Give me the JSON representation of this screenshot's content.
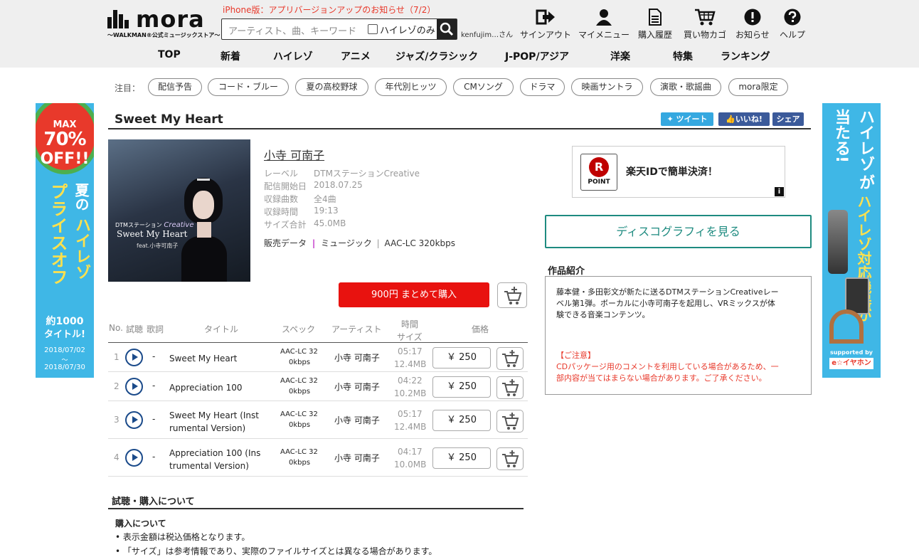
{
  "header": {
    "logo_text": "mora",
    "logo_tagline": "〜WALKMAN®公式ミュージックストア〜",
    "notice": "iPhone版：アプリバージョンアップのお知らせ（7/2）",
    "search_placeholder": "アーティスト、曲、キーワード",
    "hires_only_label": "ハイレゾのみ",
    "username": "kenfujim…さん",
    "icons": [
      {
        "label": "サインアウト",
        "icon": "signout-icon"
      },
      {
        "label": "マイメニュー",
        "icon": "person-icon"
      },
      {
        "label": "購入履歴",
        "icon": "document-icon"
      },
      {
        "label": "買い物カゴ",
        "icon": "cart-icon"
      },
      {
        "label": "お知らせ",
        "icon": "exclamation-icon"
      },
      {
        "label": "ヘルプ",
        "icon": "question-icon"
      }
    ],
    "nav": [
      "TOP",
      "新着",
      "ハイレゾ",
      "アニメ",
      "ジャズ/クラシック",
      "J-POP/アジア",
      "洋楽",
      "特集",
      "ランキング"
    ]
  },
  "featured": {
    "label": "注目：",
    "tags": [
      "配信予告",
      "コード・ブルー",
      "夏の高校野球",
      "年代別ヒッツ",
      "CMソング",
      "ドラマ",
      "映画サントラ",
      "演歌・歌謡曲",
      "mora限定"
    ]
  },
  "banner_left": {
    "max": "MAX",
    "pct": "70%",
    "off": "OFF!!",
    "title1": "夏の",
    "title2": "ハイレゾ",
    "title3": "プライスオフ",
    "count": "約1000",
    "count2": "タイトル!",
    "date1": "2018/07/02",
    "date_sep": "〜",
    "date2": "2018/07/30"
  },
  "banner_right": {
    "line1": "ハイレゾ",
    "line1b": "が",
    "line1c": "当たる!",
    "line2": "ハイレゾ対応機器が",
    "supported": "supported by",
    "sponsor": "e☆イヤホン"
  },
  "album": {
    "title": "Sweet My Heart",
    "tweet_label": "ツイート",
    "like_label": "いいね!",
    "share_label": "シェア",
    "jacket_brand": "DTMステーション",
    "jacket_brand2": "Creative",
    "jacket_title": "Sweet My Heart",
    "jacket_feat": "feat.小寺可南子",
    "artist": "小寺 可南子",
    "meta": [
      {
        "k": "レーベル",
        "v": "DTMステーションCreative"
      },
      {
        "k": "配信開始日",
        "v": "2018.07.25"
      },
      {
        "k": "収録曲数",
        "v": "全4曲"
      },
      {
        "k": "収録時間",
        "v": "19:13"
      },
      {
        "k": "サイズ合計",
        "v": "45.0MB"
      }
    ],
    "hanbai_label": "販売データ",
    "hanbai_type": "ミュージック",
    "hanbai_format": "AAC-LC 320kbps",
    "bulk_buy": "900円 まとめて購入"
  },
  "table": {
    "headers": {
      "no": "No.",
      "shichou": "試聴",
      "kashi": "歌詞",
      "title": "タイトル",
      "spec": "スペック",
      "artist": "アーティスト",
      "time": "時間",
      "size": "サイズ",
      "price": "価格"
    },
    "rows": [
      {
        "no": "1",
        "lyric": "-",
        "title": "Sweet My Heart",
        "title2": "",
        "spec1": "AAC-LC 32",
        "spec2": "0kbps",
        "artist": "小寺 可南子",
        "time": "05:17",
        "size": "12.4MB",
        "price": "￥ 250"
      },
      {
        "no": "2",
        "lyric": "-",
        "title": "Appreciation 100",
        "title2": "",
        "spec1": "AAC-LC 32",
        "spec2": "0kbps",
        "artist": "小寺 可南子",
        "time": "04:22",
        "size": "10.2MB",
        "price": "￥ 250"
      },
      {
        "no": "3",
        "lyric": "-",
        "title": "Sweet My Heart (Inst",
        "title2": "rumental Version)",
        "spec1": "AAC-LC 32",
        "spec2": "0kbps",
        "artist": "小寺 可南子",
        "time": "05:17",
        "size": "12.4MB",
        "price": "￥ 250"
      },
      {
        "no": "4",
        "lyric": "-",
        "title": "Appreciation 100 (Ins",
        "title2": "trumental Version)",
        "spec1": "AAC-LC 32",
        "spec2": "0kbps",
        "artist": "小寺 可南子",
        "time": "04:17",
        "size": "10.0MB",
        "price": "￥ 250"
      }
    ]
  },
  "about": {
    "heading": "試聴・購入について",
    "sub": "購入について",
    "items": [
      "表示金額は税込価格となります。",
      "「サイズ」は参考情報であり、実際のファイルサイズとは異なる場合があります。"
    ]
  },
  "rakuten": {
    "r": "R",
    "point": "POINT",
    "text": "楽天IDで簡単決済！",
    "info": "i"
  },
  "discography": "ディスコグラフィを見る",
  "description": {
    "heading": "作品紹介",
    "lines": [
      "藤本健・多田彰文が新たに送るDTMステーションCreativeレー",
      "ベル第1弾。ボーカルに小寺可南子を起用し、VRミックスが体",
      "験できる音楽コンテンツ。"
    ],
    "note_lines": [
      "【ご注意】",
      "CDパッケージ用のコメントを利用している場合があるため、一",
      "部内容が当てはまらない場合があります。ご了承ください。"
    ]
  },
  "colors": {
    "accent_red": "#e8120f",
    "teal": "#1e8b80",
    "play_blue": "#1a4a8a",
    "notice_red": "#e8392b"
  }
}
